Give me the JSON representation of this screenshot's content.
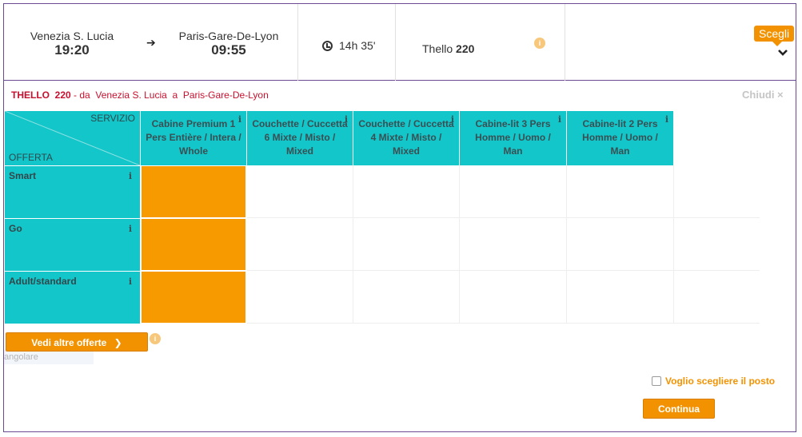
{
  "journey": {
    "departure_station": "Venezia S. Lucia",
    "departure_time": "19:20",
    "arrival_station": "Paris-Gare-De-Lyon",
    "arrival_time": "09:55",
    "duration": "14h 35'",
    "train_prefix": "Thello",
    "train_number": "220",
    "choose_label": "Scegli",
    "info_mark": "i"
  },
  "subheader": {
    "operator": "THELLO",
    "number": "220",
    "from_label": "- da",
    "from_station": "Venezia S. Lucia",
    "to_label": "a",
    "to_station": "Paris-Gare-De-Lyon",
    "close_label": "Chiudi ×"
  },
  "table": {
    "corner_top": "SERVIZIO",
    "corner_bottom": "OFFERTA",
    "info_mark": "i",
    "columns": [
      "Cabine Premium 1 Pers Entière / Intera / Whole",
      "Couchette / Cuccetta 6 Mixte / Misto / Mixed",
      "Couchette / Cuccetta 4 Mixte / Misto / Mixed",
      "Cabine-lit 3 Pers Homme / Uomo / Man",
      "Cabine-lit 2 Pers Homme / Uomo / Man"
    ],
    "rows": [
      "Smart",
      "Go",
      "Adult/standard"
    ]
  },
  "footer": {
    "more_offers_label": "Vedi altre offerte",
    "more_offers_chevron": "❯",
    "ghost_text": "angolare",
    "seat_choice_label": "Voglio scegliere il posto",
    "continue_label": "Continua"
  },
  "colors": {
    "accent": "#f39200",
    "teal": "#12c6c9",
    "frame": "#6b4a93",
    "subheader": "#c8102e"
  }
}
